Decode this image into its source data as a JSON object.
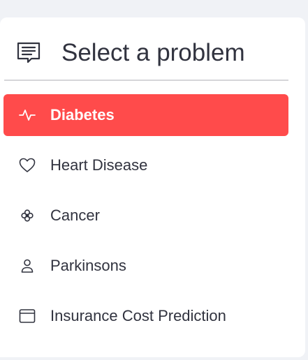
{
  "sidebar": {
    "title": "Select a problem",
    "title_icon": "chat-text-icon",
    "items": [
      {
        "label": "Diabetes",
        "icon": "activity-icon",
        "active": true
      },
      {
        "label": "Heart Disease",
        "icon": "heart-icon",
        "active": false
      },
      {
        "label": "Cancer",
        "icon": "flower-icon",
        "active": false
      },
      {
        "label": "Parkinsons",
        "icon": "person-icon",
        "active": false
      },
      {
        "label": "Insurance Cost Prediction",
        "icon": "window-icon",
        "active": false
      }
    ]
  },
  "colors": {
    "accent": "#ff4b4b",
    "text": "#31333f",
    "background": "#f0f2f6",
    "panel": "#ffffff"
  }
}
